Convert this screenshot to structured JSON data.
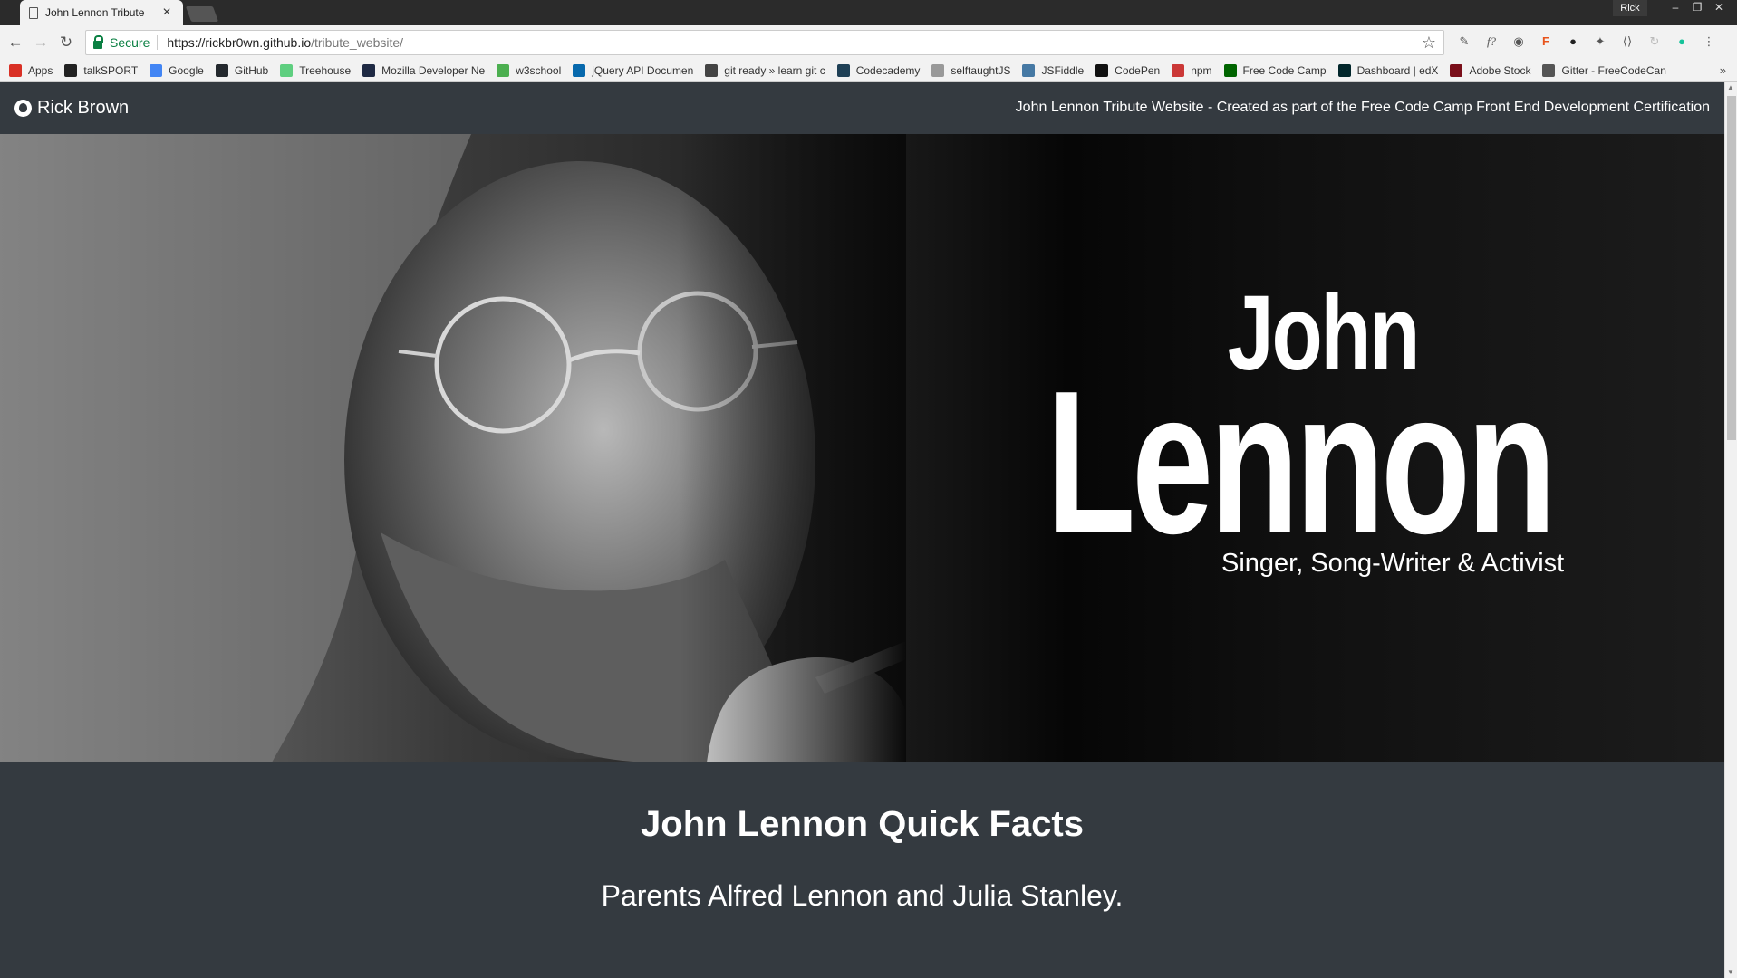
{
  "browser": {
    "tab_title": "John Lennon Tribute",
    "tab_close": "×",
    "profile_name": "Rick",
    "window_controls": [
      "–",
      "❐",
      "✕"
    ],
    "secure_label": "Secure",
    "url_host": "https://rickbr0wn.github.io",
    "url_path": "/tribute_website/",
    "bookmarks": [
      {
        "label": "Apps",
        "icon": "apps-icon",
        "color": "#d93025"
      },
      {
        "label": "talkSPORT",
        "icon": "talksport-icon",
        "color": "#222222"
      },
      {
        "label": "Google",
        "icon": "google-icon",
        "color": "#4285f4"
      },
      {
        "label": "GitHub",
        "icon": "github-icon",
        "color": "#24292e"
      },
      {
        "label": "Treehouse",
        "icon": "treehouse-icon",
        "color": "#5fcf80"
      },
      {
        "label": "Mozilla Developer Ne",
        "icon": "mdn-icon",
        "color": "#1f2a44"
      },
      {
        "label": "w3school",
        "icon": "w3school-icon",
        "color": "#4caf50"
      },
      {
        "label": "jQuery API Documen",
        "icon": "jquery-icon",
        "color": "#0769ad"
      },
      {
        "label": "git ready » learn git c",
        "icon": "git-ready-icon",
        "color": "#444444"
      },
      {
        "label": "Codecademy",
        "icon": "codecademy-icon",
        "color": "#1f4056"
      },
      {
        "label": "selftaughtJS",
        "icon": "selftaughtjs-icon",
        "color": "#999999"
      },
      {
        "label": "JSFiddle",
        "icon": "jsfiddle-icon",
        "color": "#4679a4"
      },
      {
        "label": "CodePen",
        "icon": "codepen-icon",
        "color": "#111111"
      },
      {
        "label": "npm",
        "icon": "npm-icon",
        "color": "#cb3837"
      },
      {
        "label": "Free Code Camp",
        "icon": "freecodecamp-icon",
        "color": "#006400"
      },
      {
        "label": "Dashboard | edX",
        "icon": "edx-icon",
        "color": "#02262b"
      },
      {
        "label": "Adobe Stock",
        "icon": "adobe-stock-icon",
        "color": "#7a0f1a"
      },
      {
        "label": "Gitter - FreeCodeCan",
        "icon": "gitter-icon",
        "color": "#555555"
      }
    ]
  },
  "page": {
    "brand": "Rick Brown",
    "nav_text": "John Lennon Tribute Website - Created as part of the Free Code Camp Front End Development Certification",
    "hero": {
      "first_name": "John",
      "last_name": "Lennon",
      "subtitle": "Singer, Song-Writer & Activist"
    },
    "facts_title": "John Lennon Quick Facts",
    "fact_1": "Parents Alfred Lennon and Julia Stanley."
  }
}
